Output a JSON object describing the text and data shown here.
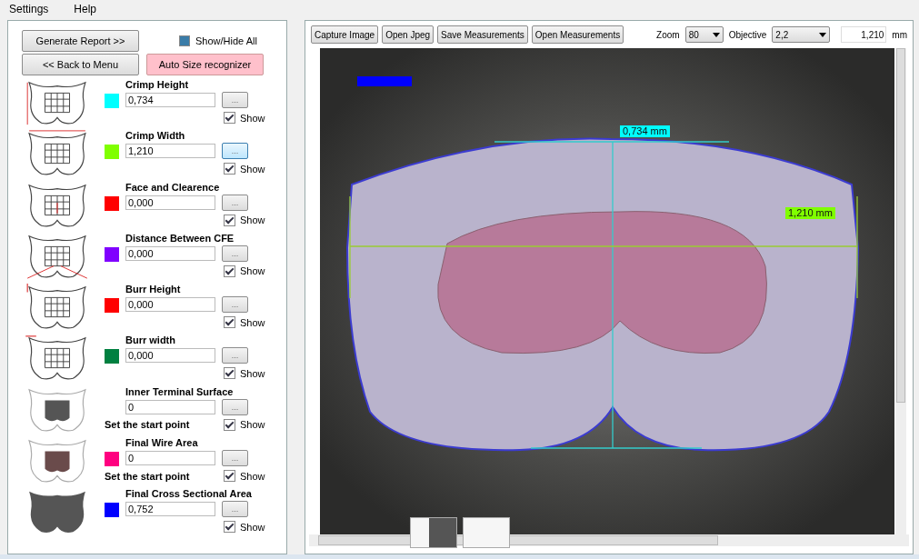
{
  "menu": [
    "Settings",
    "Help"
  ],
  "left_panel": {
    "generate_report": "Generate Report >>",
    "show_hide_all": {
      "label": "Show/Hide All",
      "checked": true
    },
    "back_to_menu": "<< Back to Menu",
    "auto_size": "Auto Size recognizer",
    "measurements": [
      {
        "kind": "height",
        "label": "Crimp Height",
        "color": "#00ffff",
        "value": "0,734",
        "button": "...",
        "focused": false,
        "show": {
          "label": "Show",
          "checked": true
        }
      },
      {
        "kind": "width",
        "label": "Crimp Width",
        "color": "#80ff00",
        "value": "1,210",
        "button": "...",
        "focused": true,
        "show": {
          "label": "Show",
          "checked": true
        }
      },
      {
        "kind": "face",
        "label": "Face and Clearence",
        "color": "#ff0000",
        "value": "0,000",
        "button": "...",
        "focused": false,
        "show": {
          "label": "Show",
          "checked": true
        }
      },
      {
        "kind": "distance",
        "label": "Distance Between CFE",
        "color": "#8000ff",
        "value": "0,000",
        "button": "...",
        "focused": false,
        "show": {
          "label": "Show",
          "checked": true
        }
      },
      {
        "kind": "burr-height",
        "label": "Burr Height",
        "color": "#ff0000",
        "value": "0,000",
        "button": "...",
        "focused": false,
        "show": {
          "label": "Show",
          "checked": true
        }
      },
      {
        "kind": "burr-width",
        "label": "Burr width",
        "color": "#008040",
        "value": "0,000",
        "button": "...",
        "focused": false,
        "show": {
          "label": "Show",
          "checked": true
        }
      },
      {
        "kind": "inner",
        "label": "Inner Terminal Surface",
        "value": "0",
        "button": "...",
        "focused": false,
        "note": "Set the start point",
        "show": {
          "label": "Show",
          "checked": true
        }
      },
      {
        "kind": "wire",
        "label": "Final Wire Area",
        "color": "#ff0080",
        "value": "0",
        "button": "...",
        "focused": false,
        "note": "Set the start point",
        "show": {
          "label": "Show",
          "checked": true
        }
      },
      {
        "kind": "solid",
        "label": "Final Cross Sectional Area",
        "color": "#0000ff",
        "value": "0,752",
        "button": "...",
        "focused": false,
        "show": {
          "label": "Show",
          "checked": true
        }
      }
    ]
  },
  "toolbar": {
    "buttons": [
      "Capture Image",
      "Open Jpeg",
      "Save Measurements",
      "Open Measurements"
    ],
    "zoom": {
      "label": "Zoom",
      "value": "80"
    },
    "objective": {
      "label": "Objective",
      "value": "2,2"
    },
    "reading": "1,210",
    "unit": "mm"
  },
  "image": {
    "overlays": [
      {
        "kind": "marker",
        "color": "#0000ff"
      },
      {
        "kind": "label",
        "text": "0,734 mm",
        "color": "#00ffff"
      },
      {
        "kind": "label",
        "text": "1,210 mm",
        "color": "#80ff00"
      }
    ]
  }
}
